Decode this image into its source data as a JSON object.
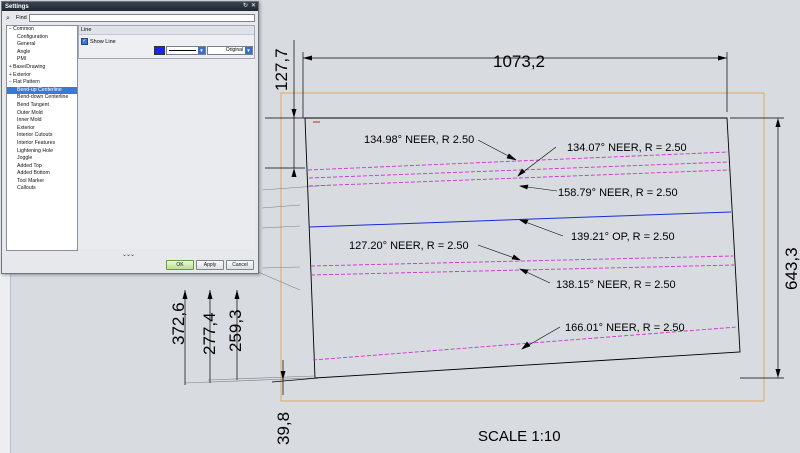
{
  "dialog": {
    "title": "Settings",
    "find_label": "Find",
    "find_value": "",
    "tree": [
      {
        "label": "Common",
        "level": 0,
        "expander": "−",
        "selected": false
      },
      {
        "label": "Configuration",
        "level": 1,
        "selected": false
      },
      {
        "label": "General",
        "level": 1,
        "selected": false
      },
      {
        "label": "Angle",
        "level": 1,
        "selected": false
      },
      {
        "label": "PMI",
        "level": 1,
        "selected": false
      },
      {
        "label": "Base/Drawing",
        "level": 0,
        "expander": "+",
        "selected": false
      },
      {
        "label": "Exterior",
        "level": 0,
        "expander": "+",
        "selected": false
      },
      {
        "label": "Flat Pattern",
        "level": 0,
        "expander": "−",
        "selected": false
      },
      {
        "label": "Bend-up Centerline",
        "level": 1,
        "selected": true
      },
      {
        "label": "Bend-down Centerline",
        "level": 1,
        "selected": false
      },
      {
        "label": "Bend Tangent",
        "level": 1,
        "selected": false
      },
      {
        "label": "Outer Mold",
        "level": 1,
        "selected": false
      },
      {
        "label": "Inner Mold",
        "level": 1,
        "selected": false
      },
      {
        "label": "Exterior",
        "level": 1,
        "selected": false
      },
      {
        "label": "Interior Cutouts",
        "level": 1,
        "selected": false
      },
      {
        "label": "Interior Features",
        "level": 1,
        "selected": false
      },
      {
        "label": "Lightening Hole",
        "level": 1,
        "selected": false
      },
      {
        "label": "Joggle",
        "level": 1,
        "selected": false
      },
      {
        "label": "Added Top",
        "level": 1,
        "selected": false
      },
      {
        "label": "Added Bottom",
        "level": 1,
        "selected": false
      },
      {
        "label": "Tool Marker",
        "level": 1,
        "selected": false
      },
      {
        "label": "Callouts",
        "level": 1,
        "selected": false
      }
    ],
    "line_group_title": "Line",
    "show_line_label": "Show Line",
    "show_line_checked": true,
    "line_color": "#1a24f0",
    "line_width_value": "Original",
    "more_indicator": "⌄⌄⌄",
    "ok_label": "OK",
    "apply_label": "Apply",
    "cancel_label": "Cancel"
  },
  "drawing": {
    "dim_width": "1073,2",
    "dim_top": "127,7",
    "dim_height": "643,3",
    "dim_372": "372,6",
    "dim_277": "277,4",
    "dim_259": "259,3",
    "dim_398": "39,8",
    "scale_label": "SCALE 1:10",
    "notes": [
      "134.98° NEER, R 2.50",
      "134.07° NEER, R = 2.50",
      "158.79° NEER, R = 2.50",
      "139.21° OP, R = 2.50",
      "127.20° NEER, R = 2.50",
      "138.15° NEER, R = 2.50",
      "166.01° NEER, R = 2.50"
    ],
    "colors": {
      "background": "#d8dbe0",
      "bend_up": "#cc33cc",
      "bend_down": "#1a2bd8",
      "border": "#e59b40"
    }
  }
}
